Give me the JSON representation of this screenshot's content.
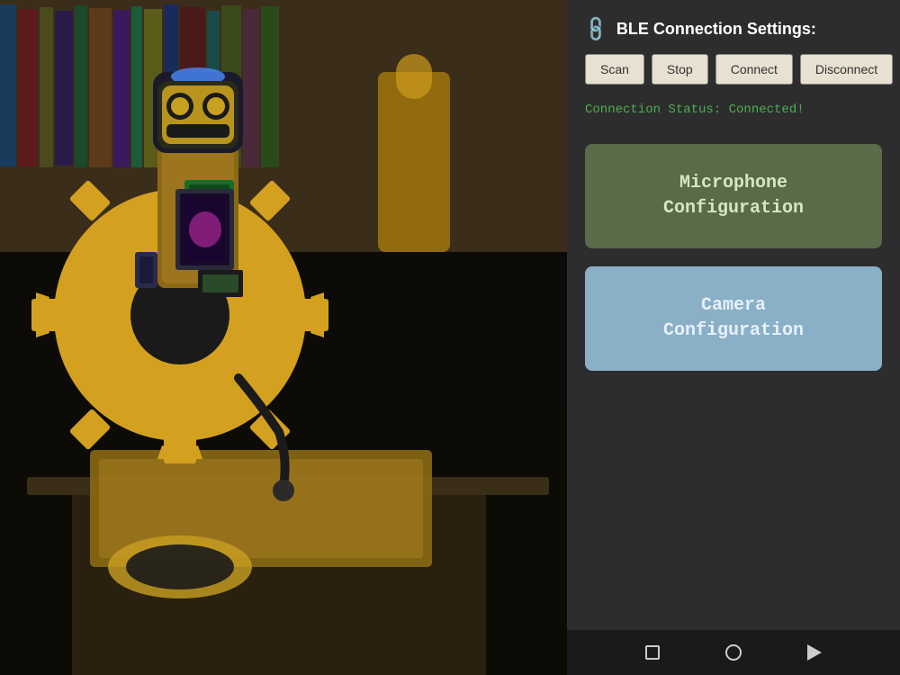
{
  "app": {
    "title": "BLE Connection Settings"
  },
  "header": {
    "icon": "link-icon",
    "title": "BLE Connection Settings:"
  },
  "buttons": {
    "scan": "Scan",
    "stop": "Stop",
    "connect": "Connect",
    "disconnect": "Disconnect"
  },
  "status": {
    "label": "Connection Status: Connected!",
    "color": "#4caf50"
  },
  "config_buttons": {
    "microphone": "Microphone\nConfiguration",
    "camera": "Camera\nConfiguration"
  },
  "nav": {
    "stop_icon": "■",
    "home_icon": "●",
    "back_icon": "◄"
  },
  "colors": {
    "background": "#2d2d2d",
    "mic_bg": "#5a6b4a",
    "mic_text": "#d4e8c0",
    "cam_bg": "#8ab0c8",
    "cam_text": "#e8f0f8",
    "status_color": "#4caf50",
    "button_bg": "#e8e0d0",
    "bottom_nav": "#1a1a1a"
  }
}
